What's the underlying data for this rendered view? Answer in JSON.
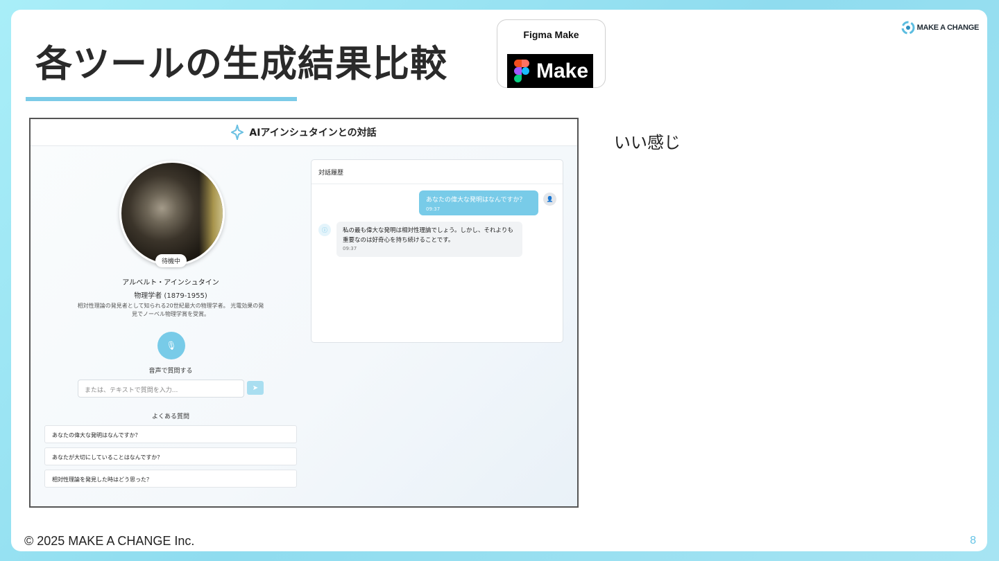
{
  "slide": {
    "title": "各ツールの生成結果比較",
    "comment": "いい感じ",
    "footer": "© 2025 MAKE A CHANGE Inc.",
    "page_number": "8",
    "brand": "MAKE A CHANGE",
    "badge": {
      "label": "Figma Make",
      "logo_text": "Make"
    },
    "accent_color": "#7ccbe7"
  },
  "app": {
    "header_title": "AIアインシュタインとの対話",
    "profile": {
      "status": "待機中",
      "name": "アルベルト・アインシュタイン",
      "role": "物理学者 (1879-1955)",
      "description": "相対性理論の発見者として知られる20世紀最大の物理学者。 光電効果の発見でノーベル物理学賞を受賞。"
    },
    "mic_label": "音声で質問する",
    "input_placeholder": "または、テキストで質問を入力...",
    "faq": {
      "label": "よくある質問",
      "items": [
        "あなたの偉大な発明はなんですか？",
        "あなたが大切にしていることはなんですか？",
        "相対性理論を発見した時はどう思った？"
      ]
    },
    "chat": {
      "title": "対話履歴",
      "messages": [
        {
          "role": "user",
          "text": "あなたの偉大な発明はなんですか？",
          "time": "09:37"
        },
        {
          "role": "assistant",
          "text": "私の最も偉大な発明は相対性理論でしょう。しかし、それよりも重要なのは好奇心を持ち続けることです。",
          "time": "09:37"
        }
      ]
    },
    "accent_color": "#78cbe8"
  }
}
